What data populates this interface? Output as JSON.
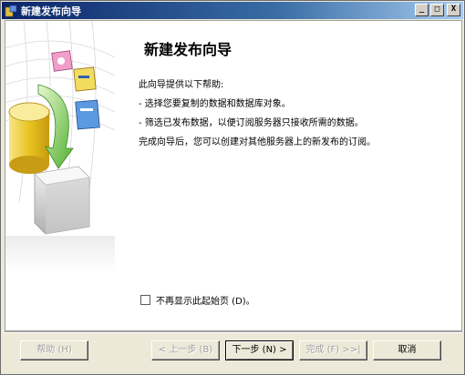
{
  "window": {
    "title": "新建发布向导",
    "minimize": "_",
    "maximize": "□",
    "close": "X"
  },
  "page": {
    "heading": "新建发布向导",
    "intro": "此向导提供以下帮助:",
    "bullet1": "- 选择您要复制的数据和数据库对象。",
    "bullet2": "- 筛选已发布数据，以便订阅服务器只接收所需的数据。",
    "outro": "完成向导后，您可以创建对其他服务器上的新发布的订阅。",
    "checkbox_label": "不再显示此起始页 (D)。",
    "checkbox_checked": false
  },
  "buttons": {
    "help": "帮助 (H)",
    "back": "< 上一步 (B)",
    "next": "下一步 (N) >",
    "finish": "完成 (F) >>|",
    "cancel": "取消"
  },
  "colors": {
    "title_bar": "#0a246a",
    "dialog_face": "#ece9d8",
    "disabled_text": "#a0a0a0"
  }
}
